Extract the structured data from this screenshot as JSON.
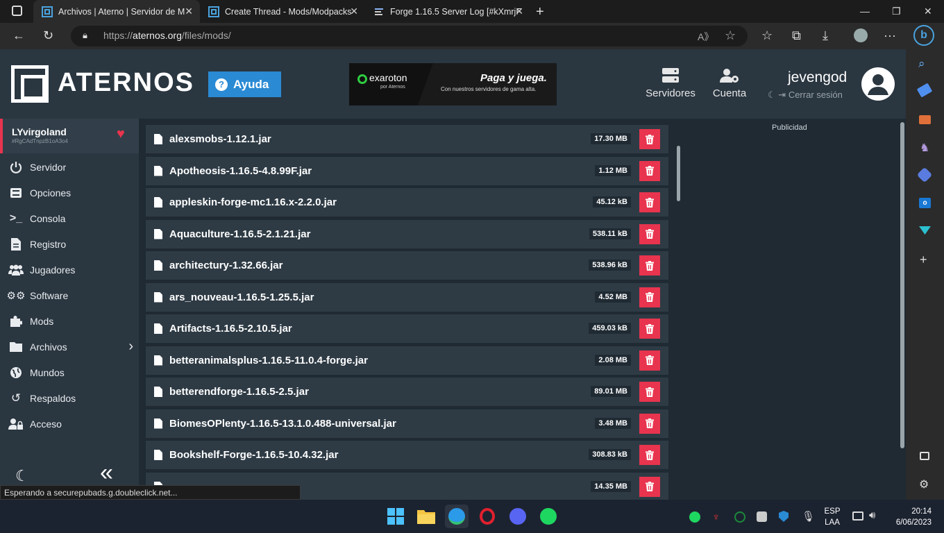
{
  "browser": {
    "tabs": [
      {
        "label": "Archivos | Aterno | Servidor de M",
        "active": true
      },
      {
        "label": "Create Thread - Mods/Modpacks",
        "active": false
      },
      {
        "label": "Forge 1.16.5 Server Log [#kXmrjF",
        "active": false
      }
    ],
    "url_prefix": "https://",
    "url_host": "aternos.org",
    "url_path": "/files/mods/"
  },
  "header": {
    "logo_text": "ATERNOS",
    "help_label": "Ayuda",
    "banner": {
      "brand": "exaroton",
      "brand_sub": "por Aternos",
      "headline": "Paga y juega.",
      "tagline": "Con nuestros servidores de gama alta."
    },
    "servers_label": "Servidores",
    "account_label": "Cuenta",
    "username": "jevengod",
    "logout_label": "Cerrar sesión"
  },
  "server": {
    "name": "LYvirgoland",
    "id": "#RgCAdTnpzB1oA3o4"
  },
  "nav": {
    "items": [
      {
        "label": "Servidor",
        "icon": "power-icon"
      },
      {
        "label": "Opciones",
        "icon": "sliders-icon"
      },
      {
        "label": "Consola",
        "icon": "terminal-icon"
      },
      {
        "label": "Registro",
        "icon": "document-icon"
      },
      {
        "label": "Jugadores",
        "icon": "users-icon"
      },
      {
        "label": "Software",
        "icon": "gears-icon"
      },
      {
        "label": "Mods",
        "icon": "puzzle-icon"
      },
      {
        "label": "Archivos",
        "icon": "folder-icon"
      },
      {
        "label": "Mundos",
        "icon": "globe-icon"
      },
      {
        "label": "Respaldos",
        "icon": "history-icon"
      },
      {
        "label": "Acceso",
        "icon": "user-lock-icon"
      }
    ]
  },
  "mods": [
    {
      "name": "alexsmobs-1.12.1.jar",
      "size": "17.30 MB"
    },
    {
      "name": "Apotheosis-1.16.5-4.8.99F.jar",
      "size": "1.12 MB"
    },
    {
      "name": "appleskin-forge-mc1.16.x-2.2.0.jar",
      "size": "45.12 kB"
    },
    {
      "name": "Aquaculture-1.16.5-2.1.21.jar",
      "size": "538.11 kB"
    },
    {
      "name": "architectury-1.32.66.jar",
      "size": "538.96 kB"
    },
    {
      "name": "ars_nouveau-1.16.5-1.25.5.jar",
      "size": "4.52 MB"
    },
    {
      "name": "Artifacts-1.16.5-2.10.5.jar",
      "size": "459.03 kB"
    },
    {
      "name": "betteranimalsplus-1.16.5-11.0.4-forge.jar",
      "size": "2.08 MB"
    },
    {
      "name": "betterendforge-1.16.5-2.5.jar",
      "size": "89.01 MB"
    },
    {
      "name": "BiomesOPlenty-1.16.5-13.1.0.488-universal.jar",
      "size": "3.48 MB"
    },
    {
      "name": "Bookshelf-Forge-1.16.5-10.4.32.jar",
      "size": "308.83 kB"
    },
    {
      "name": "",
      "size": "14.35 MB"
    }
  ],
  "ad_label": "Publicidad",
  "status_text": "Esperando a securepubads.g.doubleclick.net...",
  "taskbar": {
    "lang_top": "ESP",
    "lang_bottom": "LAA",
    "time": "20:14",
    "date": "6/06/2023"
  },
  "colors": {
    "accent_red": "#e8344e",
    "help_blue": "#2a8ad4",
    "row_bg": "#2e3b45",
    "page_bg": "#1f2a33"
  }
}
